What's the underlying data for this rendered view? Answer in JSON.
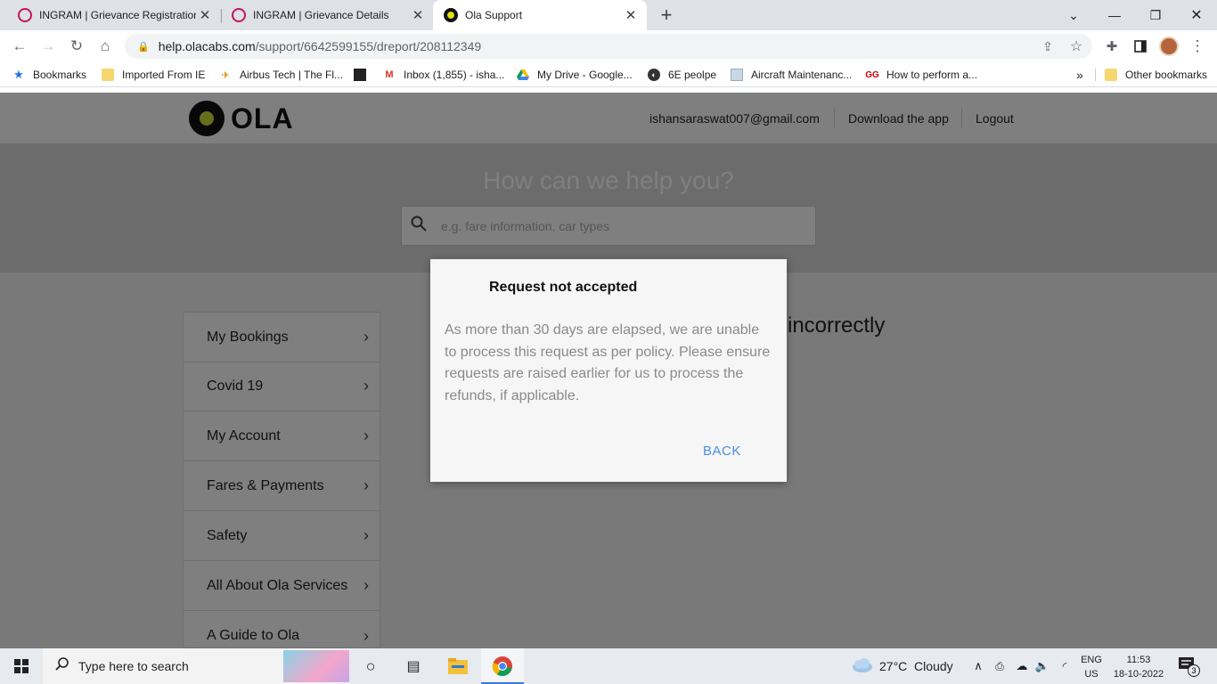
{
  "browser": {
    "tabs": [
      {
        "title": "INGRAM | Grievance Registration",
        "active": false
      },
      {
        "title": "INGRAM | Grievance Details",
        "active": false
      },
      {
        "title": "Ola Support",
        "active": true
      }
    ],
    "new_tab_glyph": "+",
    "url_host": "help.olacabs.com",
    "url_path": "/support/6642599155/dreport/208112349",
    "bookmarks": [
      {
        "label": "Bookmarks",
        "icon": "star-icon"
      },
      {
        "label": "Imported From IE",
        "icon": "folder-icon"
      },
      {
        "label": "Airbus Tech | The Fl...",
        "icon": "airbus-icon"
      },
      {
        "label": "",
        "icon": "dark-site-icon"
      },
      {
        "label": "Inbox (1,855) - isha...",
        "icon": "gmail-icon"
      },
      {
        "label": "My Drive - Google...",
        "icon": "drive-icon"
      },
      {
        "label": "6E peolpe",
        "icon": "globe-icon"
      },
      {
        "label": "Aircraft Maintenanc...",
        "icon": "page-icon"
      },
      {
        "label": "How to perform a...",
        "icon": "gfg-icon"
      }
    ],
    "overflow_glyph": "»",
    "other_bookmarks": "Other bookmarks"
  },
  "site": {
    "logo_text": "OLA",
    "user_email": "ishansaraswat007@gmail.com",
    "download_label": "Download the app",
    "logout_label": "Logout",
    "hero_title": "How can we help you?",
    "search_placeholder": "e.g. fare information, car types",
    "sidebar": [
      {
        "label": "My Bookings"
      },
      {
        "label": "Covid 19"
      },
      {
        "label": "My Account"
      },
      {
        "label": "Fares & Payments"
      },
      {
        "label": "Safety"
      },
      {
        "label": "All About Ola Services"
      },
      {
        "label": "A Guide to Ola"
      }
    ],
    "content_heading_fragment": "incorrectly"
  },
  "dialog": {
    "title": "Request not accepted",
    "message": "As more than 30 days are elapsed, we are unable to process this request as per policy. Please ensure requests are raised earlier for us to process the refunds, if applicable.",
    "back_label": "BACK"
  },
  "taskbar": {
    "search_placeholder": "Type here to search",
    "weather": "27°C  Cloudy",
    "lang_line1": "ENG",
    "lang_line2": "US",
    "time": "11:53",
    "date": "18-10-2022",
    "notification_count": "3"
  },
  "colors": {
    "ola_yellow": "#cddc39",
    "link_blue": "#4a90e2",
    "overlay": "rgba(0,0,0,0.5)"
  }
}
